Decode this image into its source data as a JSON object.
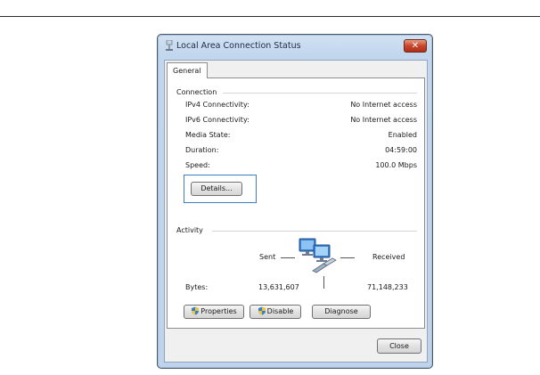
{
  "window": {
    "title": "Local Area Connection Status",
    "close_glyph": "✕"
  },
  "tabs": [
    {
      "label": "General"
    }
  ],
  "connection": {
    "group_label": "Connection",
    "rows": [
      {
        "label": "IPv4 Connectivity:",
        "value": "No Internet access"
      },
      {
        "label": "IPv6 Connectivity:",
        "value": "No Internet access"
      },
      {
        "label": "Media State:",
        "value": "Enabled"
      },
      {
        "label": "Duration:",
        "value": "04:59:00"
      },
      {
        "label": "Speed:",
        "value": "100.0 Mbps"
      }
    ],
    "details_button": "Details..."
  },
  "activity": {
    "group_label": "Activity",
    "sent_label": "Sent",
    "received_label": "Received",
    "bytes_label": "Bytes:",
    "bytes_sent": "13,631,607",
    "bytes_received": "71,148,233",
    "icon": "network-computers-icon"
  },
  "buttons": {
    "properties": "Properties",
    "disable": "Disable",
    "diagnose": "Diagnose",
    "close": "Close"
  },
  "colors": {
    "accent_focus": "#3b7fc0",
    "close_button": "#c8452a"
  }
}
